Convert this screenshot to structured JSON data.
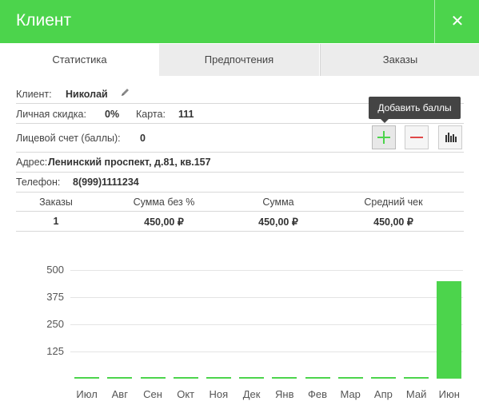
{
  "header": {
    "title": "Клиент",
    "close_icon": "close-icon"
  },
  "tabs": [
    {
      "label": "Статистика",
      "active": true
    },
    {
      "label": "Предпочтения",
      "active": false
    },
    {
      "label": "Заказы",
      "active": false
    }
  ],
  "client": {
    "name_label": "Клиент:",
    "name": "Николай",
    "discount_label": "Личная скидка:",
    "discount": "0%",
    "card_label": "Карта:",
    "card": "111",
    "account_label": "Лицевой счет (баллы):",
    "account": "0",
    "address_label": "Адрес:",
    "address": "Ленинский проспект, д.81, кв.157",
    "phone_label": "Телефон:",
    "phone": "8(999)1111234"
  },
  "tooltip": "Добавить баллы",
  "buttons": {
    "add_icon": "plus-icon",
    "remove_icon": "minus-icon",
    "stats_icon": "bar-chart-icon"
  },
  "table": {
    "headers": [
      "Заказы",
      "Сумма без %",
      "Сумма",
      "Средний чек"
    ],
    "row": [
      "1",
      "450,00 ₽",
      "450,00 ₽",
      "450,00 ₽"
    ]
  },
  "accent_color": "#4cd44c",
  "chart_data": {
    "type": "bar",
    "categories": [
      "Июл",
      "Авг",
      "Сен",
      "Окт",
      "Ноя",
      "Дек",
      "Янв",
      "Фев",
      "Мар",
      "Апр",
      "Май",
      "Июн"
    ],
    "values": [
      0,
      0,
      0,
      0,
      0,
      0,
      0,
      0,
      0,
      0,
      0,
      450
    ],
    "ylim": [
      0,
      500
    ],
    "yticks": [
      "500",
      "375",
      "250",
      "125"
    ],
    "ytick_values": [
      500,
      375,
      250,
      125
    ],
    "grid": true,
    "title": "",
    "xlabel": "",
    "ylabel": ""
  }
}
